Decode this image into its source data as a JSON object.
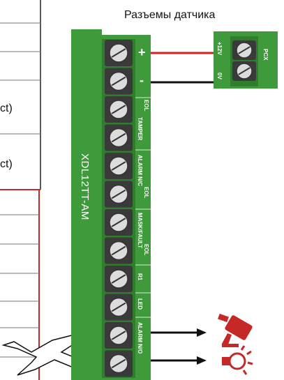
{
  "diagram": {
    "left_table": {
      "cell_texts": [
        "ct)",
        "ct)"
      ]
    },
    "sensor_title": "Разъемы датчика",
    "board": {
      "model": "XDL12TT-AM",
      "polarity": {
        "plus": "+",
        "minus": "-"
      },
      "terminal_labels": [
        "EOL",
        "TAMPER",
        "ALARM N/C",
        "EOL",
        "MASK/FAULT",
        "EOL",
        "R1",
        "LED",
        "ALARM N/O"
      ]
    },
    "sensor_connector": {
      "name": "PCX",
      "pins": [
        "+12V",
        "0V"
      ]
    },
    "wire_colors": {
      "plus": "#d61f1f",
      "minus": "#111111",
      "board": "#3f9a3c",
      "board_dark": "#2f7d2d"
    },
    "output_icons": [
      "camera-icon",
      "bulb-icon"
    ]
  }
}
